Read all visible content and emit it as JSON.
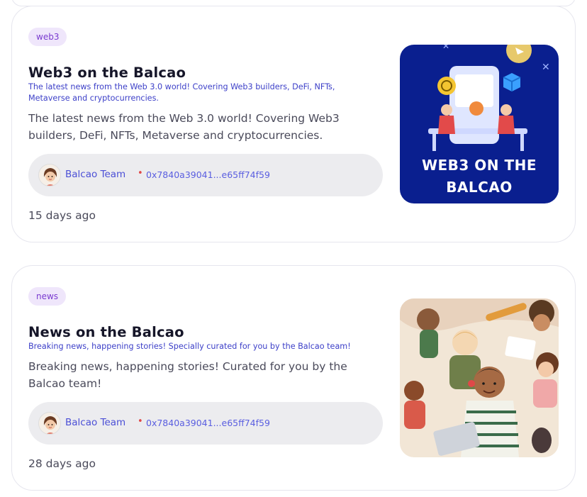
{
  "articles": [
    {
      "tag": "web3",
      "title": "Web3 on the Balcao",
      "subtitle": "The latest news from the Web 3.0 world! Covering Web3 builders, DeFi, NFTs, Metaverse and cryptocurrencies.",
      "description": "The latest news from the Web 3.0 world! Covering Web3 builders, DeFi, NFTs, Metaverse and cryptocurrencies.",
      "author_name": "Balcao Team",
      "author_separator": "•",
      "author_address": "0x7840a39041...e65ff74f59",
      "date": "15 days ago",
      "thumbnail_caption_line1": "WEB3 ON THE",
      "thumbnail_caption_line2": "BALCAO",
      "thumbnail_bg": "#0a1f8f"
    },
    {
      "tag": "news",
      "title": "News on the Balcao",
      "subtitle": "Breaking news, happening stories! Specially curated for you by the Balcao team!",
      "description": "Breaking news, happening stories! Curated for you by the Balcao team!",
      "author_name": "Balcao Team",
      "author_separator": "•",
      "author_address": "0x7840a39041...e65ff74f59",
      "date": "28 days ago",
      "thumbnail_bg": "#f2e6d6"
    }
  ],
  "colors": {
    "tag_bg": "#efe6fb",
    "tag_text": "#7a3bd0",
    "subtitle": "#3c3fc8",
    "author_link": "#4b4fd6"
  }
}
